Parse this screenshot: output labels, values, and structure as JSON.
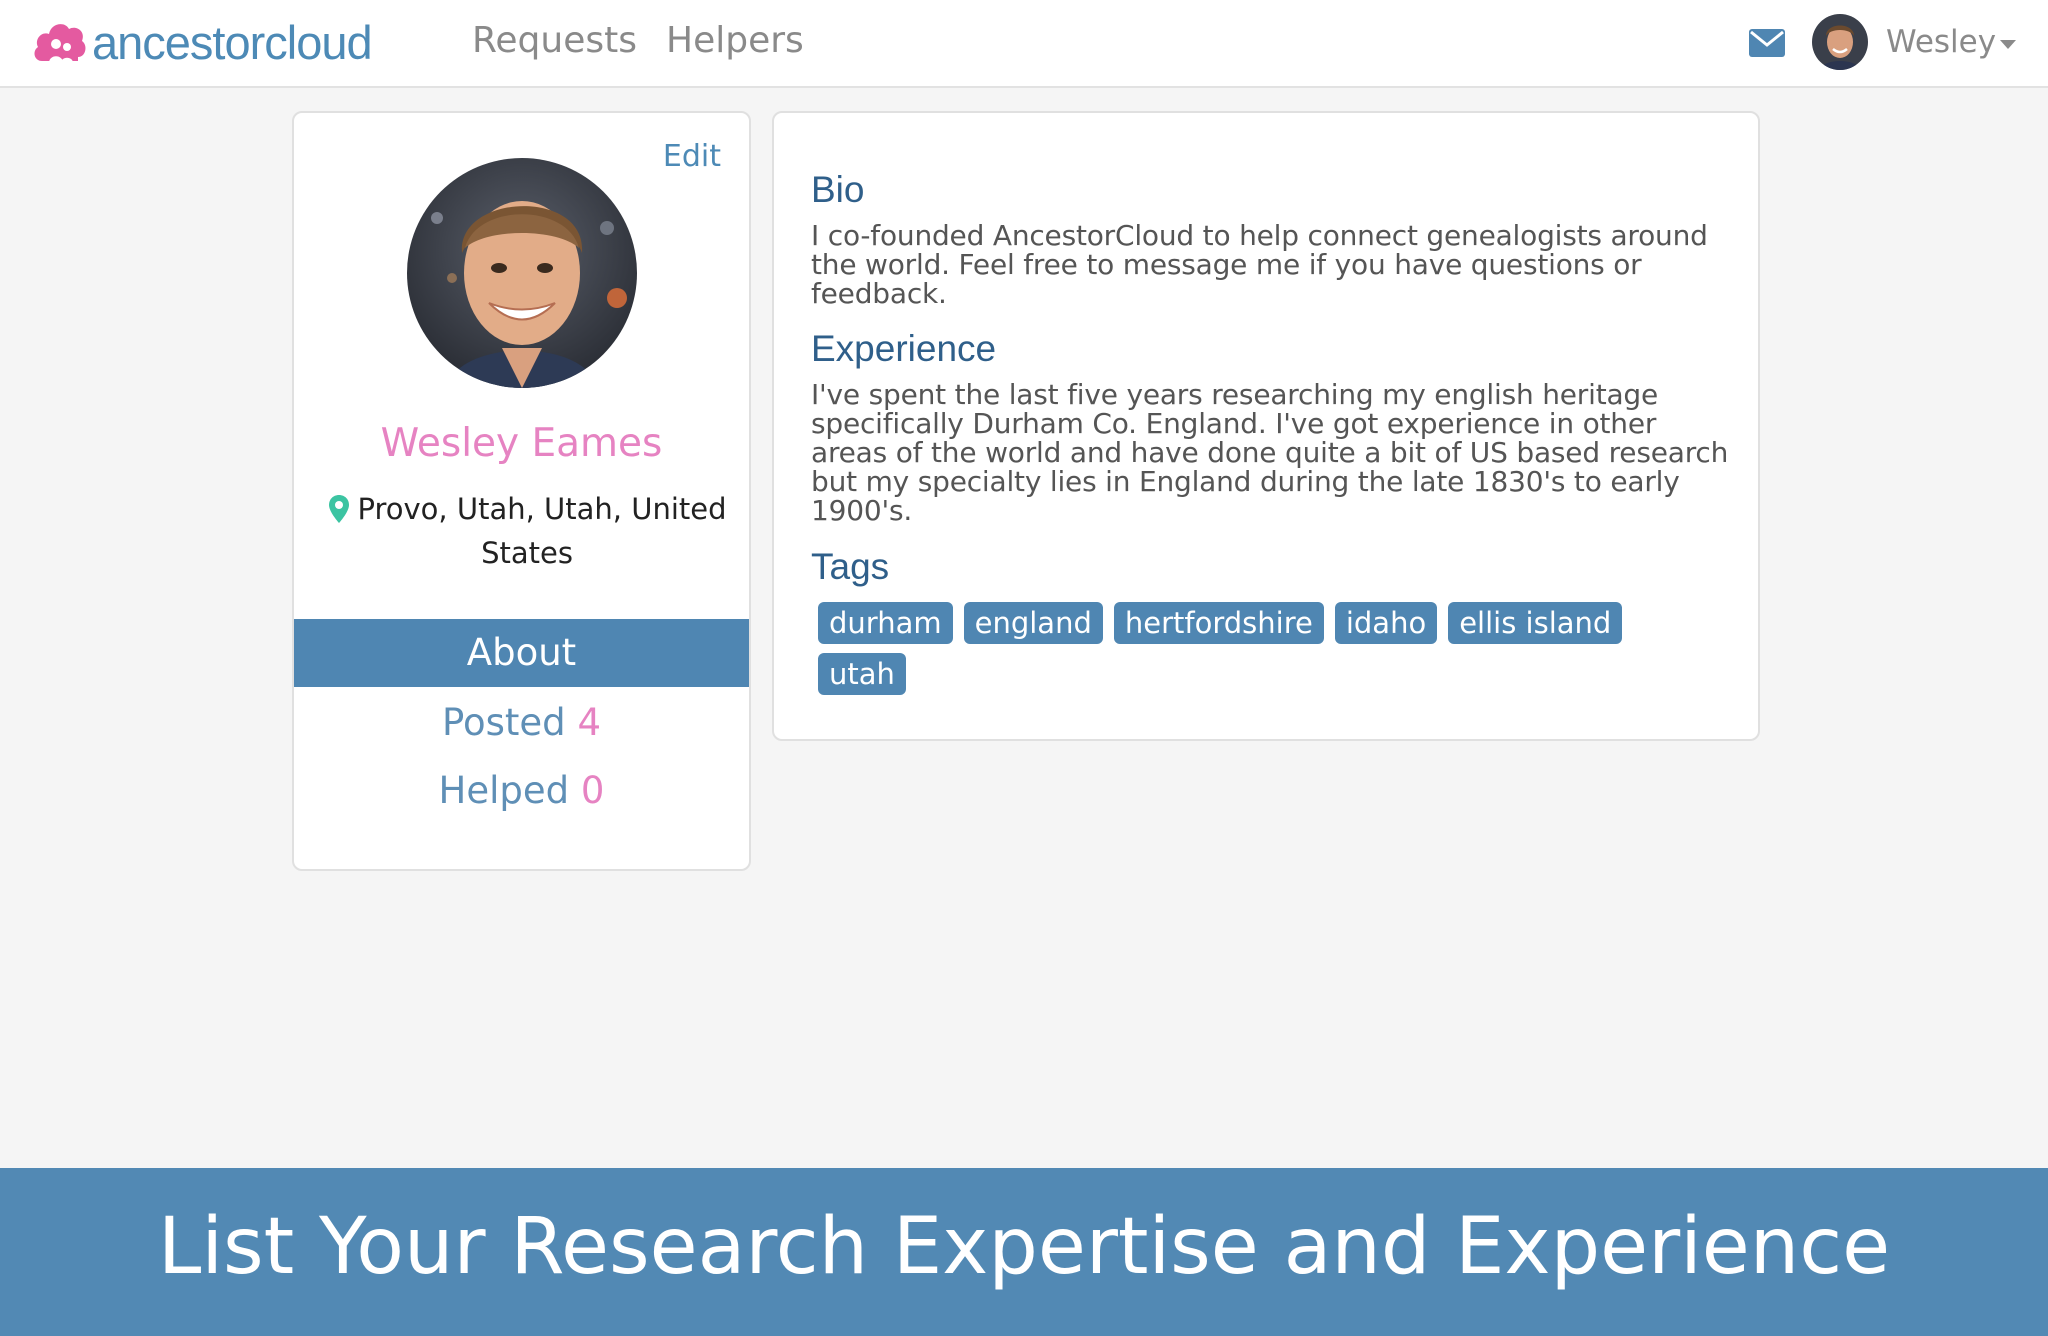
{
  "header": {
    "logo_text": "ancestorcloud",
    "nav": [
      {
        "label": "Requests"
      },
      {
        "label": "Helpers"
      }
    ],
    "user_name": "Wesley",
    "icons": [
      "mail-icon",
      "user-avatar",
      "chevron-down-icon"
    ]
  },
  "profile": {
    "edit_label": "Edit",
    "name": "Wesley Eames",
    "location": "Provo, Utah, Utah, United States",
    "tabs": {
      "about_label": "About",
      "posted_label": "Posted",
      "posted_count": "4",
      "helped_label": "Helped",
      "helped_count": "0"
    }
  },
  "about": {
    "bio_heading": "Bio",
    "bio_text": "I co-founded AncestorCloud to help connect genealogists around the world. Feel free to message me if you have questions or feedback.",
    "experience_heading": "Experience",
    "experience_text": "I've spent the last five years researching my english heritage specifically Durham Co. England. I've got experience in other areas of the world and have done quite a bit of US based research but my specialty lies in England during the late 1830's to early 1900's.",
    "tags_heading": "Tags",
    "tags": [
      "durham",
      "england",
      "hertfordshire",
      "idaho",
      "ellis island",
      "utah"
    ]
  },
  "banner": {
    "text": "List Your Research Expertise and Experience"
  },
  "colors": {
    "brand_blue": "#4f86b2",
    "accent_pink": "#e683c2",
    "pin_green": "#3cc4a2",
    "background": "#f5f5f5"
  }
}
